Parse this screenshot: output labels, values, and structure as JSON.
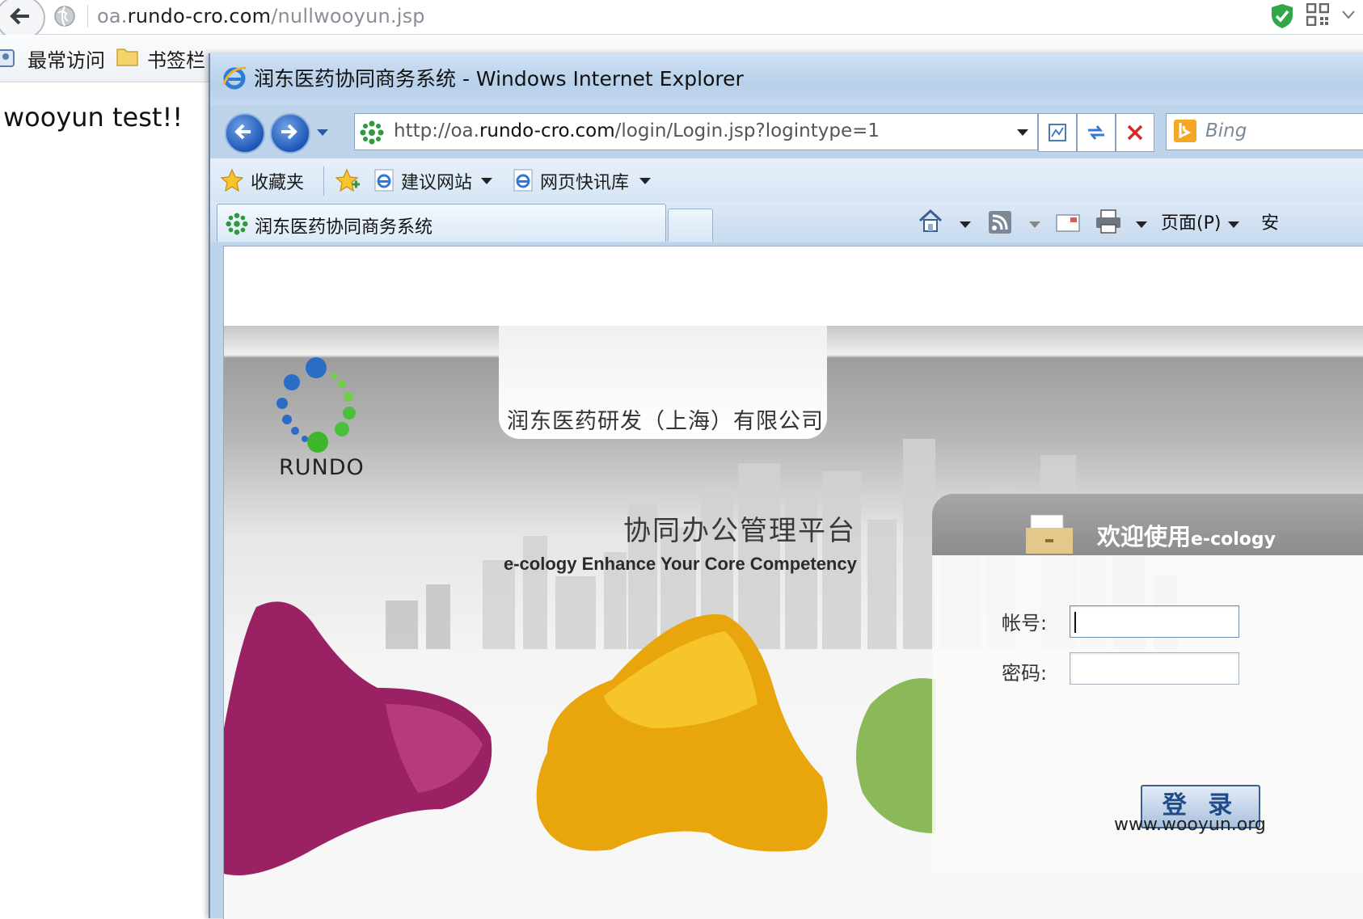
{
  "outer_browser": {
    "url_prefix": "oa.",
    "url_host": "rundo-cro.com",
    "url_path": "/nullwooyun.jsp",
    "bookmarks": [
      "最常访问",
      "书签栏"
    ],
    "page_text": "wooyun test!!"
  },
  "ie": {
    "title": "润东医药协同商务系统 - Windows Internet Explorer",
    "address_prefix": "http://oa.",
    "address_host": "rundo-cro.com",
    "address_path": "/login/Login.jsp?logintype=1",
    "search_placeholder": "Bing",
    "favorites_label": "收藏夹",
    "favorites_links": [
      "建议网站",
      "网页快讯库"
    ],
    "tab_title": "润东医药协同商务系统",
    "command_page": "页面(P)",
    "command_safety": "安"
  },
  "login_page": {
    "company_name": "润东医药研发（上海）有限公司",
    "logo_text": "RUNDO",
    "platform_title": "协同办公管理平台",
    "platform_subtitle": "e-cology Enhance Your Core Competency",
    "welcome_prefix": "欢迎使用",
    "welcome_product": "e-cology",
    "username_label": "帐号:",
    "password_label": "密码:",
    "username_value": "",
    "password_value": "",
    "login_button": "登 录"
  },
  "watermark": "www.wooyun.org",
  "colors": {
    "ie_frame": "#bcd3ea",
    "login_header": "#999999",
    "button_text": "#1f4b87"
  }
}
